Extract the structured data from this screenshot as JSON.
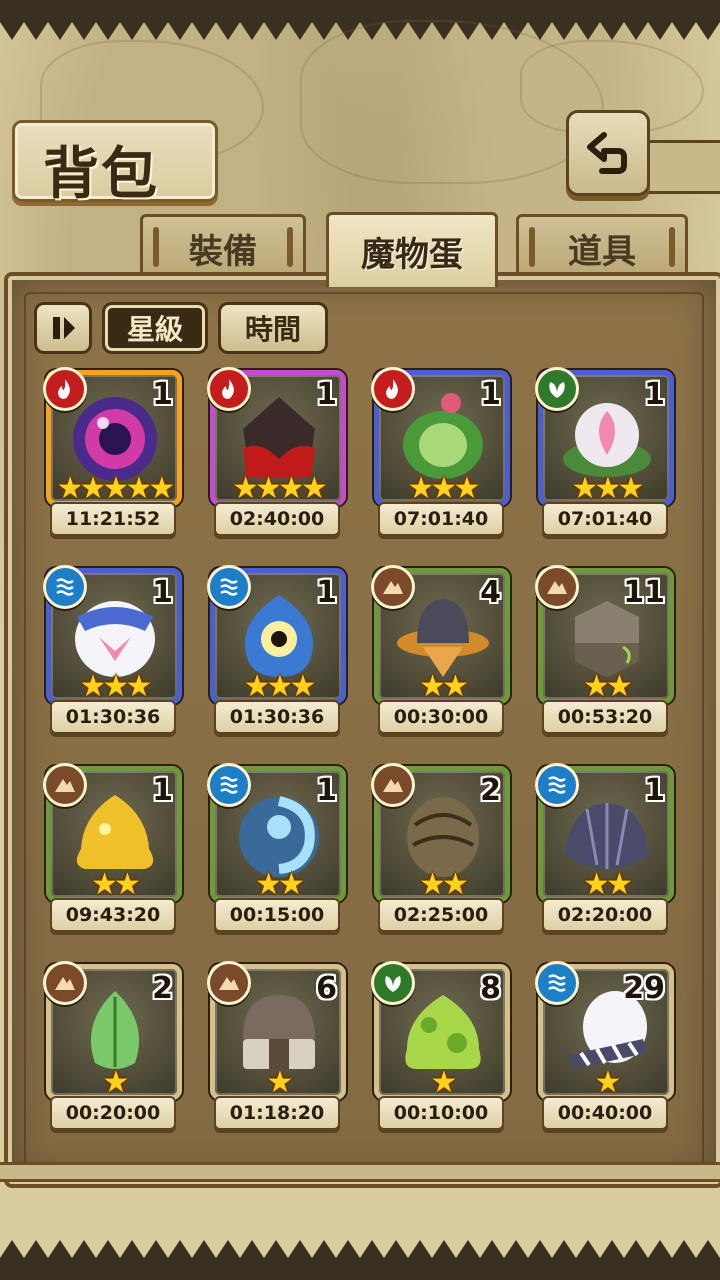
{
  "header": {
    "title": "背包"
  },
  "tabs": [
    {
      "label": "裝備",
      "active": false
    },
    {
      "label": "魔物蛋",
      "active": true
    },
    {
      "label": "道具",
      "active": false
    }
  ],
  "sort": {
    "pause_icon": "pause-icon",
    "star_label": "星級",
    "time_label": "時間",
    "active": "星級"
  },
  "eggs": [
    {
      "element": "fire",
      "count": "1",
      "stars": 5,
      "timer": "11:21:52",
      "frame": "orange"
    },
    {
      "element": "fire",
      "count": "1",
      "stars": 4,
      "timer": "02:40:00",
      "frame": "purple"
    },
    {
      "element": "fire",
      "count": "1",
      "stars": 3,
      "timer": "07:01:40",
      "frame": "blue"
    },
    {
      "element": "plant",
      "count": "1",
      "stars": 3,
      "timer": "07:01:40",
      "frame": "blue"
    },
    {
      "element": "water",
      "count": "1",
      "stars": 3,
      "timer": "01:30:36",
      "frame": "blue"
    },
    {
      "element": "water",
      "count": "1",
      "stars": 3,
      "timer": "01:30:36",
      "frame": "blue"
    },
    {
      "element": "earth",
      "count": "4",
      "stars": 2,
      "timer": "00:30:00",
      "frame": "green"
    },
    {
      "element": "earth",
      "count": "11",
      "stars": 2,
      "timer": "00:53:20",
      "frame": "green"
    },
    {
      "element": "earth",
      "count": "1",
      "stars": 2,
      "timer": "09:43:20",
      "frame": "green"
    },
    {
      "element": "water",
      "count": "1",
      "stars": 2,
      "timer": "00:15:00",
      "frame": "green"
    },
    {
      "element": "earth",
      "count": "2",
      "stars": 2,
      "timer": "02:25:00",
      "frame": "green"
    },
    {
      "element": "water",
      "count": "1",
      "stars": 2,
      "timer": "02:20:00",
      "frame": "green"
    },
    {
      "element": "earth",
      "count": "2",
      "stars": 1,
      "timer": "00:20:00",
      "frame": "tan"
    },
    {
      "element": "earth",
      "count": "6",
      "stars": 1,
      "timer": "01:18:20",
      "frame": "tan"
    },
    {
      "element": "plant",
      "count": "8",
      "stars": 1,
      "timer": "00:10:00",
      "frame": "tan"
    },
    {
      "element": "water",
      "count": "29",
      "stars": 1,
      "timer": "00:40:00",
      "frame": "tan"
    }
  ],
  "colors": {
    "fire": "#c41d1d",
    "water": "#1c7fc8",
    "earth": "#7a4a2a",
    "plant": "#2e7a2a",
    "panel": "#8e7348",
    "parchment": "#d9cc9e"
  }
}
